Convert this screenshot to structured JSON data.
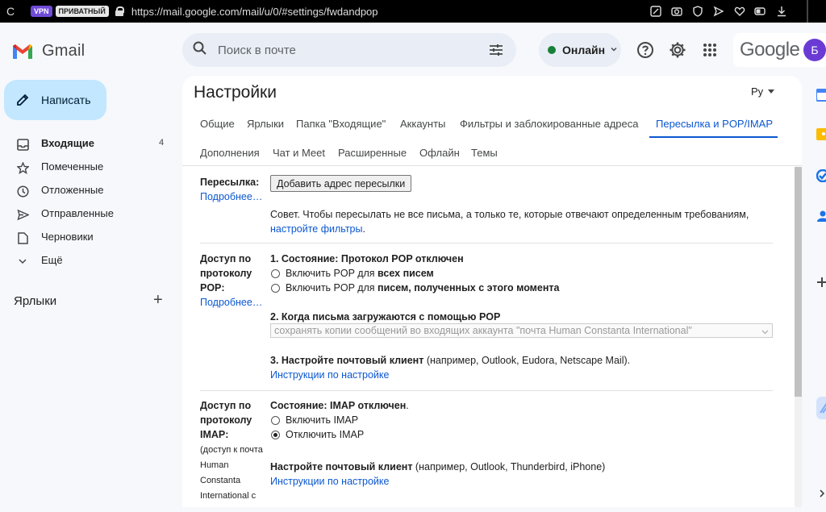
{
  "browser": {
    "badge_vpn": "VPN",
    "badge_private": "ПРИВАТНЫЙ",
    "url": "https://mail.google.com/mail/u/0/#settings/fwdandpop"
  },
  "header": {
    "app_name": "Gmail",
    "search_placeholder": "Поиск в почте",
    "status_label": "Онлайн",
    "status_color": "#188038",
    "google_word": "Google",
    "avatar_letter": "Б"
  },
  "sidebar": {
    "compose_label": "Написать",
    "items": [
      {
        "label": "Входящие",
        "count": "4",
        "icon": "inbox-icon",
        "bold": true
      },
      {
        "label": "Помеченные",
        "icon": "star-icon"
      },
      {
        "label": "Отложенные",
        "icon": "clock-icon"
      },
      {
        "label": "Отправленные",
        "icon": "send-icon"
      },
      {
        "label": "Черновики",
        "icon": "draft-icon"
      },
      {
        "label": "Ещё",
        "icon": "chevron-down-icon"
      }
    ],
    "labels_heading": "Ярлыки"
  },
  "settings": {
    "title": "Настройки",
    "lang": "Ру",
    "tabs_row1": [
      "Общие",
      "Ярлыки",
      "Папка \"Входящие\"",
      "Аккаунты",
      "Фильтры и заблокированные адреса",
      "Пересылка и POP/IMAP"
    ],
    "tabs_row2": [
      "Дополнения",
      "Чат и Meet",
      "Расширенные",
      "Офлайн",
      "Темы"
    ],
    "active_tab": "Пересылка и POP/IMAP",
    "forwarding": {
      "label": "Пересылка:",
      "more": "Подробнее…",
      "button": "Добавить адрес пересылки",
      "tip": "Совет. Чтобы пересылать не все письма, а только те, которые отвечают определенным требованиям,",
      "tip_link": "настройте фильтры",
      "tip_end": "."
    },
    "pop": {
      "label_1": "Доступ по",
      "label_2": "протоколу",
      "label_3": "POP:",
      "more": "Подробнее…",
      "status": "1. Состояние: Протокол POP отключен",
      "opt1_prefix": "Включить POP для ",
      "opt1_bold": "всех писем",
      "opt2_prefix": "Включить POP для ",
      "opt2_bold": "писем, полученных с этого момента",
      "when_heading": "2. Когда письма загружаются с помощью POP",
      "when_select": "сохранять копии сообщений во входящих аккаунта \"почта Human Constanta International\"",
      "client_bold": "3. Настройте почтовый клиент",
      "client_rest": " (например, Outlook, Eudora, Netscape Mail).",
      "client_link": "Инструкции по настройке"
    },
    "imap": {
      "label_1": "Доступ по",
      "label_2": "протоколу",
      "label_3": "IMAP:",
      "note_1": "(доступ к почта",
      "note_2": "Human",
      "note_3": "Constanta",
      "note_4": "International с",
      "status": "Состояние: IMAP отключен",
      "status_end": ".",
      "opt_enable": "Включить IMAP",
      "opt_disable": "Отключить IMAP",
      "client_bold": "Настройте почтовый клиент",
      "client_rest": " (например, Outlook, Thunderbird, iPhone)",
      "client_link": "Инструкции по настройке"
    }
  },
  "colors": {
    "accent": "#0b57d0",
    "compose_bg": "#c2e7ff",
    "page_bg": "#f6f8fc"
  }
}
